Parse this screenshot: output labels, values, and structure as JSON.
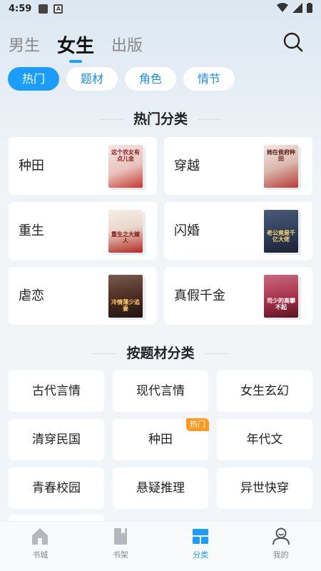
{
  "status": {
    "time": "4:59",
    "a_label": "A"
  },
  "top_tabs": [
    {
      "label": "男生",
      "active": false
    },
    {
      "label": "女生",
      "active": true
    },
    {
      "label": "出版",
      "active": false
    }
  ],
  "filters": [
    {
      "label": "热门",
      "active": true
    },
    {
      "label": "题材",
      "active": false
    },
    {
      "label": "角色",
      "active": false
    },
    {
      "label": "情节",
      "active": false
    }
  ],
  "hot_section": {
    "title": "热门分类",
    "items": [
      {
        "label": "种田",
        "cover_text": "这个农女有点儿金",
        "cover_color": "#c9362f"
      },
      {
        "label": "穿越",
        "cover_text": "她在侯府种田",
        "cover_color": "#b93a36"
      },
      {
        "label": "重生",
        "cover_text": "重生之大嫁人",
        "cover_color": "#b22a24"
      },
      {
        "label": "闪婚",
        "cover_text": "老公竟是千亿大佬",
        "cover_color": "#2b3a55"
      },
      {
        "label": "虐恋",
        "cover_text": "冷情薄少追妻",
        "cover_color": "#4a2a22"
      },
      {
        "label": "真假千金",
        "cover_text": "司少的高攀不起",
        "cover_color": "#a8314a"
      }
    ]
  },
  "topic_section": {
    "title": "按题材分类",
    "items": [
      {
        "label": "古代言情",
        "badge": ""
      },
      {
        "label": "现代言情",
        "badge": ""
      },
      {
        "label": "女生玄幻",
        "badge": ""
      },
      {
        "label": "清穿民国",
        "badge": ""
      },
      {
        "label": "种田",
        "badge": "热门"
      },
      {
        "label": "年代文",
        "badge": ""
      },
      {
        "label": "青春校园",
        "badge": ""
      },
      {
        "label": "悬疑推理",
        "badge": ""
      },
      {
        "label": "异世快穿",
        "badge": ""
      }
    ]
  },
  "bottom_nav": [
    {
      "label": "书城",
      "icon": "home-icon",
      "active": false
    },
    {
      "label": "书架",
      "icon": "bookshelf-icon",
      "active": false
    },
    {
      "label": "分类",
      "icon": "category-icon",
      "active": true
    },
    {
      "label": "我的",
      "icon": "profile-icon",
      "active": false
    }
  ],
  "colors": {
    "accent": "#1a9dfd",
    "badge": "#ff9a1f"
  }
}
